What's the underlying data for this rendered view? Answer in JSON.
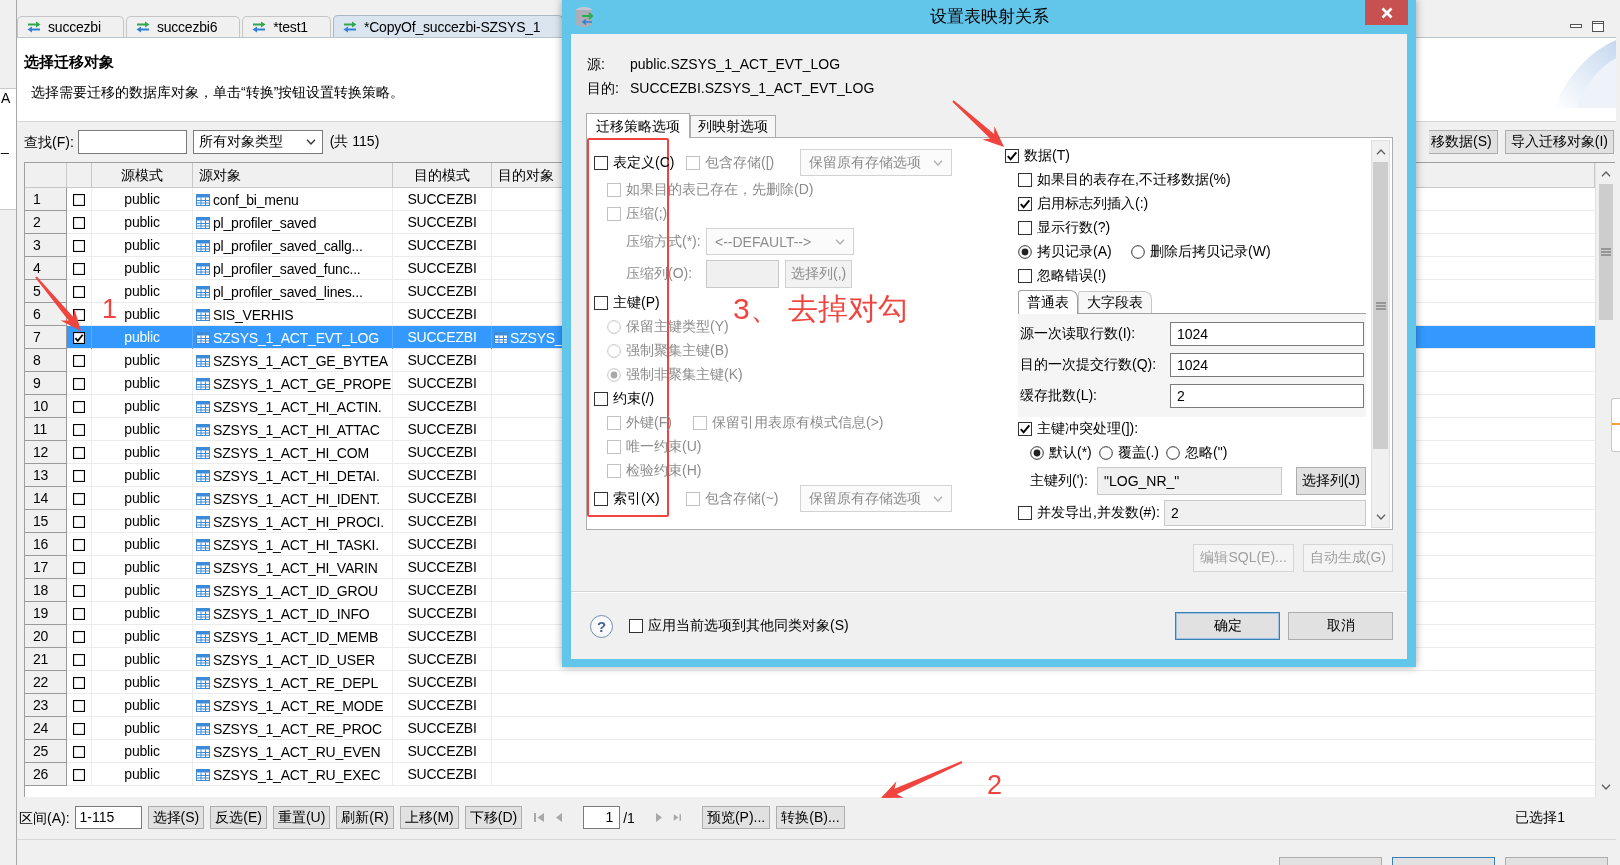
{
  "side_panel": {
    "texts": [
      "A",
      "_"
    ]
  },
  "editor_tabs": [
    {
      "label": "succezbi",
      "selected": false
    },
    {
      "label": "succezbi6",
      "selected": false
    },
    {
      "label": "*test1",
      "selected": false
    },
    {
      "label": "*CopyOf_succezbi-SZSYS_1",
      "selected": true
    }
  ],
  "page_header": {
    "title": "选择迁移对象",
    "description": "选择需要迁移的数据库对象，单击“转换”按钮设置转换策略。"
  },
  "filter_bar": {
    "find_label": "查找(F):",
    "object_type": "所有对象类型",
    "count": "(共 115)",
    "buttons": [
      "移数据(S)",
      "导入迁移对象(I)"
    ]
  },
  "table": {
    "columns": [
      "源模式",
      "源对象",
      "目的模式",
      "目的对象"
    ],
    "rows": [
      {
        "number": "1",
        "checked": false,
        "selected": false,
        "source_schema": "public",
        "source_object": "conf_bi_menu",
        "target_schema": "SUCCEZBI"
      },
      {
        "number": "2",
        "checked": false,
        "selected": false,
        "source_schema": "public",
        "source_object": "pl_profiler_saved",
        "target_schema": "SUCCEZBI"
      },
      {
        "number": "3",
        "checked": false,
        "selected": false,
        "source_schema": "public",
        "source_object": "pl_profiler_saved_callg...",
        "target_schema": "SUCCEZBI"
      },
      {
        "number": "4",
        "checked": false,
        "selected": false,
        "source_schema": "public",
        "source_object": "pl_profiler_saved_func...",
        "target_schema": "SUCCEZBI"
      },
      {
        "number": "5",
        "checked": false,
        "selected": false,
        "source_schema": "public",
        "source_object": "pl_profiler_saved_lines...",
        "target_schema": "SUCCEZBI"
      },
      {
        "number": "6",
        "checked": false,
        "selected": false,
        "source_schema": "public",
        "source_object": "SIS_VERHIS",
        "target_schema": "SUCCEZBI"
      },
      {
        "number": "7",
        "checked": true,
        "selected": true,
        "source_schema": "public",
        "source_object": "SZSYS_1_ACT_EVT_LOG",
        "target_schema": "SUCCEZBI",
        "target_object": "SZSYS_"
      },
      {
        "number": "8",
        "checked": false,
        "selected": false,
        "source_schema": "public",
        "source_object": "SZSYS_1_ACT_GE_BYTEA",
        "target_schema": "SUCCEZBI"
      },
      {
        "number": "9",
        "checked": false,
        "selected": false,
        "source_schema": "public",
        "source_object": "SZSYS_1_ACT_GE_PROPE",
        "target_schema": "SUCCEZBI"
      },
      {
        "number": "10",
        "checked": false,
        "selected": false,
        "source_schema": "public",
        "source_object": "SZSYS_1_ACT_HI_ACTIN.",
        "target_schema": "SUCCEZBI"
      },
      {
        "number": "11",
        "checked": false,
        "selected": false,
        "source_schema": "public",
        "source_object": "SZSYS_1_ACT_HI_ATTAC",
        "target_schema": "SUCCEZBI"
      },
      {
        "number": "12",
        "checked": false,
        "selected": false,
        "source_schema": "public",
        "source_object": "SZSYS_1_ACT_HI_COM",
        "target_schema": "SUCCEZBI"
      },
      {
        "number": "13",
        "checked": false,
        "selected": false,
        "source_schema": "public",
        "source_object": "SZSYS_1_ACT_HI_DETAI.",
        "target_schema": "SUCCEZBI"
      },
      {
        "number": "14",
        "checked": false,
        "selected": false,
        "source_schema": "public",
        "source_object": "SZSYS_1_ACT_HI_IDENT.",
        "target_schema": "SUCCEZBI"
      },
      {
        "number": "15",
        "checked": false,
        "selected": false,
        "source_schema": "public",
        "source_object": "SZSYS_1_ACT_HI_PROCI.",
        "target_schema": "SUCCEZBI"
      },
      {
        "number": "16",
        "checked": false,
        "selected": false,
        "source_schema": "public",
        "source_object": "SZSYS_1_ACT_HI_TASKI.",
        "target_schema": "SUCCEZBI"
      },
      {
        "number": "17",
        "checked": false,
        "selected": false,
        "source_schema": "public",
        "source_object": "SZSYS_1_ACT_HI_VARIN",
        "target_schema": "SUCCEZBI"
      },
      {
        "number": "18",
        "checked": false,
        "selected": false,
        "source_schema": "public",
        "source_object": "SZSYS_1_ACT_ID_GROU",
        "target_schema": "SUCCEZBI"
      },
      {
        "number": "19",
        "checked": false,
        "selected": false,
        "source_schema": "public",
        "source_object": "SZSYS_1_ACT_ID_INFO",
        "target_schema": "SUCCEZBI"
      },
      {
        "number": "20",
        "checked": false,
        "selected": false,
        "source_schema": "public",
        "source_object": "SZSYS_1_ACT_ID_MEMB",
        "target_schema": "SUCCEZBI"
      },
      {
        "number": "21",
        "checked": false,
        "selected": false,
        "source_schema": "public",
        "source_object": "SZSYS_1_ACT_ID_USER",
        "target_schema": "SUCCEZBI"
      },
      {
        "number": "22",
        "checked": false,
        "selected": false,
        "source_schema": "public",
        "source_object": "SZSYS_1_ACT_RE_DEPL",
        "target_schema": "SUCCEZBI"
      },
      {
        "number": "23",
        "checked": false,
        "selected": false,
        "source_schema": "public",
        "source_object": "SZSYS_1_ACT_RE_MODE",
        "target_schema": "SUCCEZBI"
      },
      {
        "number": "24",
        "checked": false,
        "selected": false,
        "source_schema": "public",
        "source_object": "SZSYS_1_ACT_RE_PROC",
        "target_schema": "SUCCEZBI"
      },
      {
        "number": "25",
        "checked": false,
        "selected": false,
        "source_schema": "public",
        "source_object": "SZSYS_1_ACT_RU_EVEN",
        "target_schema": "SUCCEZBI"
      },
      {
        "number": "26",
        "checked": false,
        "selected": false,
        "source_schema": "public",
        "source_object": "SZSYS_1_ACT_RU_EXEC",
        "target_schema": "SUCCEZBI"
      }
    ]
  },
  "toolbar": {
    "range_label": "区间(A):",
    "range_value": "1-115",
    "buttons": [
      "选择(S)",
      "反选(E)",
      "重置(U)",
      "刷新(R)",
      "上移(M)",
      "下移(D)"
    ],
    "page_value": "1",
    "page_total": "/1",
    "page_buttons": [
      "预览(P)...",
      "转换(B)..."
    ],
    "status": "已选择1"
  },
  "dialog": {
    "title": "设置表映射关系",
    "source": {
      "label": "源:",
      "value": "public.SZSYS_1_ACT_EVT_LOG"
    },
    "target": {
      "label": "目的:",
      "value": "SUCCEZBI.SZSYS_1_ACT_EVT_LOG"
    },
    "tabs": [
      {
        "label": "迁移策略选项",
        "selected": true
      },
      {
        "label": "列映射选项",
        "selected": false
      }
    ],
    "strategy_groups": [
      {
        "items": [
          {
            "kind": "checkbox",
            "label": "表定义(C)",
            "checked": false,
            "disabled": false
          },
          {
            "kind": "checkbox",
            "label": "包含存储([)",
            "checked": false,
            "disabled": true
          },
          {
            "kind": "select",
            "value": "保留原有存储选项",
            "disabled": true
          }
        ],
        "children": [
          {
            "items": [
              {
                "kind": "checkbox",
                "label": "如果目的表已存在，先删除(D)",
                "checked": false,
                "disabled": true
              }
            ]
          },
          {
            "items": [
              {
                "kind": "checkbox",
                "label": "压缩(;)",
                "checked": false,
                "disabled": true
              }
            ]
          },
          {
            "items": [
              {
                "kind": "label",
                "text": "压缩方式(*):",
                "disabled": true
              },
              {
                "kind": "select",
                "value": "<--DEFAULT-->",
                "disabled": true
              }
            ]
          },
          {
            "items": [
              {
                "kind": "label",
                "text": "压缩列(O):",
                "disabled": true
              },
              {
                "kind": "field",
                "disabled": true
              },
              {
                "kind": "button",
                "label": "选择列(,)",
                "disabled": true
              }
            ]
          }
        ]
      },
      {
        "items": [
          {
            "kind": "checkbox",
            "label": "主键(P)",
            "checked": false,
            "disabled": false
          }
        ],
        "children": [
          {
            "items": [
              {
                "kind": "radio",
                "label": "保留主键类型(Y)",
                "selected": false,
                "disabled": true
              }
            ]
          },
          {
            "items": [
              {
                "kind": "radio",
                "label": "强制聚集主键(B)",
                "selected": false,
                "disabled": true
              }
            ]
          },
          {
            "items": [
              {
                "kind": "radio",
                "label": "强制非聚集主键(K)",
                "selected": true,
                "disabled": true
              }
            ]
          }
        ]
      },
      {
        "items": [
          {
            "kind": "checkbox",
            "label": "约束(/)",
            "checked": false,
            "disabled": false
          }
        ],
        "children": [
          {
            "items": [
              {
                "kind": "checkbox",
                "label": "外键(F)",
                "checked": false,
                "disabled": true
              },
              {
                "kind": "checkbox",
                "label": "保留引用表原有模式信息(>)",
                "checked": false,
                "disabled": true
              }
            ]
          },
          {
            "items": [
              {
                "kind": "checkbox",
                "label": "唯一约束(U)",
                "checked": false,
                "disabled": true
              }
            ]
          },
          {
            "items": [
              {
                "kind": "checkbox",
                "label": "检验约束(H)",
                "checked": false,
                "disabled": true
              }
            ]
          }
        ]
      },
      {
        "items": [
          {
            "kind": "checkbox",
            "label": "索引(X)",
            "checked": false,
            "disabled": false
          },
          {
            "kind": "checkbox",
            "label": "包含存储(~)",
            "checked": false,
            "disabled": true
          },
          {
            "kind": "select",
            "value": "保留原有存储选项",
            "disabled": true
          }
        ]
      }
    ],
    "data_panel": {
      "head": {
        "items": [
          {
            "kind": "checkbox",
            "label": "数据(T)",
            "checked": true,
            "disabled": false
          }
        ]
      },
      "options": [
        {
          "items": [
            {
              "kind": "checkbox",
              "label": "如果目的表存在,不迁移数据(%)",
              "checked": false,
              "disabled": false
            }
          ]
        },
        {
          "items": [
            {
              "kind": "checkbox",
              "label": "启用标志列插入(:)",
              "checked": true,
              "disabled": false
            }
          ]
        },
        {
          "items": [
            {
              "kind": "checkbox",
              "label": "显示行数(?)",
              "checked": false,
              "disabled": false
            }
          ]
        },
        {
          "items": [
            {
              "kind": "radio",
              "label": "拷贝记录(A)",
              "selected": true,
              "disabled": false
            },
            {
              "kind": "radio",
              "label": "删除后拷贝记录(W)",
              "selected": false,
              "disabled": false
            }
          ]
        },
        {
          "items": [
            {
              "kind": "checkbox",
              "label": "忽略错误(!)",
              "checked": false,
              "disabled": false
            }
          ]
        }
      ],
      "subtabs": [
        {
          "label": "普通表",
          "selected": true
        },
        {
          "label": "大字段表",
          "selected": false
        }
      ],
      "batch_fields": [
        {
          "label": "源一次读取行数(I):",
          "value": "1024"
        },
        {
          "label": "目的一次提交行数(Q):",
          "value": "1024"
        },
        {
          "label": "缓存批数(L):",
          "value": "2"
        }
      ],
      "groups": [
        {
          "items": [
            {
              "kind": "checkbox",
              "label": "主键冲突处理(]):",
              "checked": true,
              "disabled": false
            }
          ],
          "children": [
            {
              "items": [
                {
                  "kind": "radio",
                  "label": "默认(*)",
                  "selected": true,
                  "disabled": false
                },
                {
                  "kind": "radio",
                  "label": "覆盖(.)",
                  "selected": false,
                  "disabled": false
                },
                {
                  "kind": "radio",
                  "label": "忽略(\")",
                  "selected": false,
                  "disabled": false
                }
              ]
            },
            {
              "items": [
                {
                  "kind": "label",
                  "text": "主键列('):",
                  "disabled": false
                },
                {
                  "kind": "field",
                  "value": "\"LOG_NR_\"",
                  "disabled": true
                },
                {
                  "kind": "button",
                  "label": "选择列(J)",
                  "disabled": false
                }
              ]
            }
          ]
        },
        {
          "items": [
            {
              "kind": "checkbox",
              "label": "并发导出,并发数(#):",
              "checked": false,
              "disabled": false
            },
            {
              "kind": "field",
              "value": "2",
              "disabled": true
            }
          ]
        }
      ]
    },
    "actions": [
      {
        "label": "编辑SQL(E)...",
        "disabled": true
      },
      {
        "label": "自动生成(G)",
        "disabled": true
      }
    ],
    "help_mark": "?",
    "apply_all": {
      "label": "应用当前选项到其他同类对象(S)",
      "checked": false
    },
    "buttons": [
      {
        "label": "确定",
        "default": true
      },
      {
        "label": "取消",
        "default": false
      }
    ]
  },
  "annotations": [
    {
      "kind": "arrow",
      "label": "1"
    },
    {
      "kind": "arrow",
      "label": "2"
    },
    {
      "kind": "arrow"
    },
    {
      "kind": "frame",
      "label": "3、 去掉对勾"
    }
  ]
}
